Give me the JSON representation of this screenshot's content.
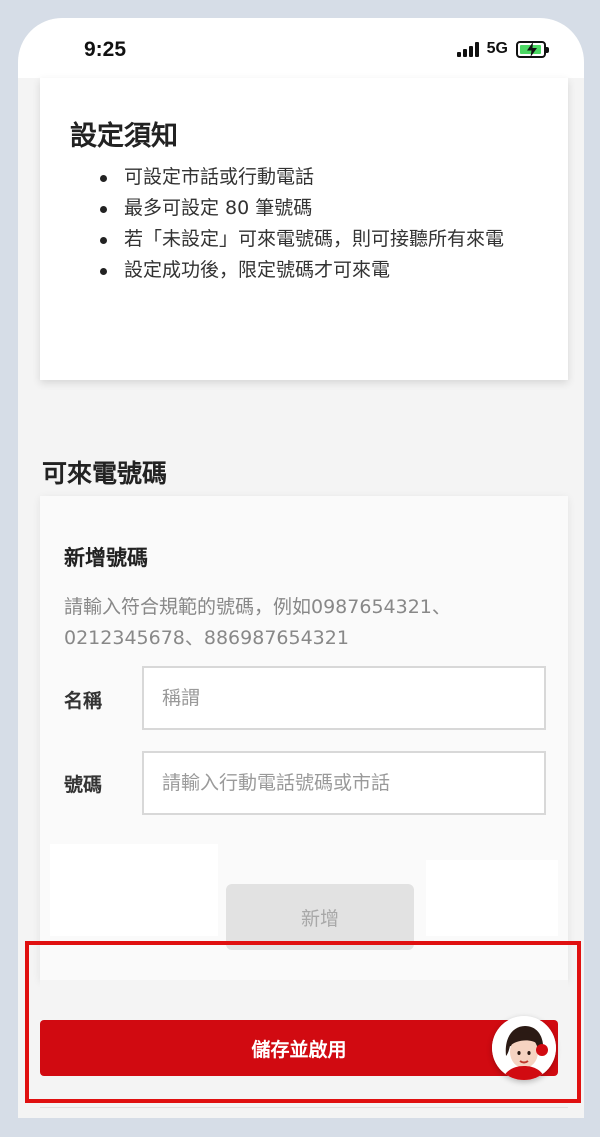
{
  "status_bar": {
    "time": "9:25",
    "network": "5G",
    "battery_state": "charging",
    "icons": [
      "signal-icon",
      "battery-charging-icon"
    ]
  },
  "notice": {
    "title": "設定須知",
    "items": [
      "可設定市話或行動電話",
      "最多可設定 80 筆號碼",
      "若「未設定」可來電號碼，則可接聽所有來電",
      "設定成功後，限定號碼才可來電"
    ]
  },
  "allowed_numbers": {
    "section_title": "可來電號碼",
    "add_title": "新增號碼",
    "hint": "請輸入符合規範的號碼，例如0987654321、0212345678、886987654321",
    "name_label": "名稱",
    "name_placeholder": "稱謂",
    "name_value": "",
    "number_label": "號碼",
    "number_placeholder": "請輸入行動電話號碼或市話",
    "number_value": "",
    "add_button": "新增",
    "add_button_enabled": false
  },
  "footer": {
    "save_button": "儲存並啟用"
  },
  "colors": {
    "primary_red": "#d10a11",
    "highlight_red": "#e01010",
    "disabled_gray": "#e2e2e2"
  },
  "assistant": {
    "icon": "chat-assistant-avatar-icon"
  }
}
